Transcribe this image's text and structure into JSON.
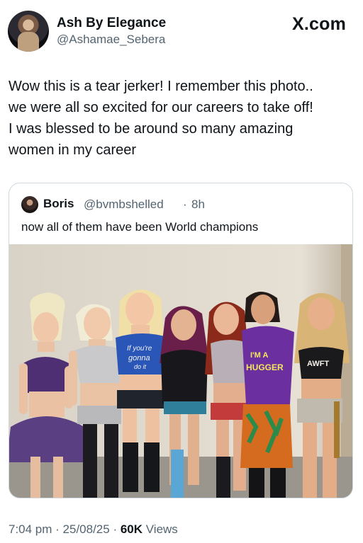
{
  "author": {
    "display_name": "Ash By Elegance",
    "handle": "@Ashamae_Sebera"
  },
  "brand": "X.com",
  "tweet": {
    "text": "Wow this is a tear jerker! I remember this photo..\nwe were all so excited for our careers to take off!\nI was blessed to be around so many amazing\nwomen in my career"
  },
  "quoted_tweet": {
    "name": "Boris",
    "handle": "@bvmbshelled",
    "separator": "·",
    "time": "8h",
    "text": "now all of them have been World champions",
    "photo_shirt_texts": [
      "If you're gonna do it",
      "I'M A HUGGER",
      "AWFT"
    ]
  },
  "meta": {
    "time": "7:04 pm",
    "separator1": " · ",
    "date": "25/08/25",
    "separator2": " · ",
    "views_count": "60K",
    "views_label": " Views"
  },
  "colors": {
    "text_primary": "#0f1419",
    "text_secondary": "#536471",
    "card_border": "#cfd9de"
  }
}
